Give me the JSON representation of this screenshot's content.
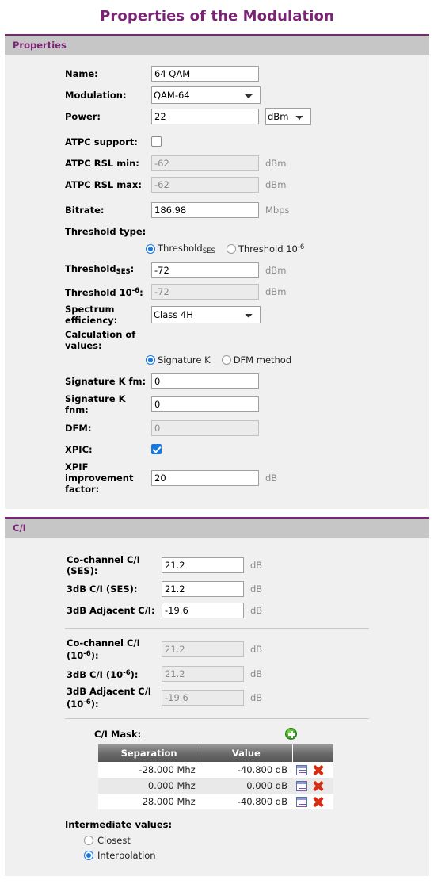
{
  "page": {
    "title": "Properties of the Modulation",
    "accent_color": "#7b2476"
  },
  "properties": {
    "section_title": "Properties",
    "name": {
      "label": "Name:",
      "value": "64 QAM"
    },
    "modulation": {
      "label": "Modulation:",
      "value": "QAM-64"
    },
    "power": {
      "label": "Power:",
      "value": "22",
      "unit_value": "dBm"
    },
    "atpc_support": {
      "label": "ATPC support:"
    },
    "atpc_rsl_min": {
      "label": "ATPC RSL min:",
      "value": "-62",
      "unit": "dBm"
    },
    "atpc_rsl_max": {
      "label": "ATPC RSL max:",
      "value": "-62",
      "unit": "dBm"
    },
    "bitrate": {
      "label": "Bitrate:",
      "value": "186.98",
      "unit": "Mbps"
    },
    "threshold_type": {
      "label": "Threshold type:",
      "option_ses_text": "Threshold",
      "option_ses_sub": "SES",
      "option_10_text": "Threshold 10",
      "option_10_sup": "-6"
    },
    "threshold_ses": {
      "label_text": "Threshold",
      "label_sub": "SES",
      "label_end": ":",
      "value": "-72",
      "unit": "dBm"
    },
    "threshold_10": {
      "label_text": "Threshold 10",
      "label_sup": "-6",
      "label_end": ":",
      "value": "-72",
      "unit": "dBm"
    },
    "spectrum_efficiency": {
      "label": "Spectrum efficiency:",
      "value": "Class 4H"
    },
    "calculation": {
      "label": "Calculation of values:",
      "option_signature": "Signature K",
      "option_dfm": "DFM method"
    },
    "signature_k_fm": {
      "label": "Signature K fm:",
      "value": "0"
    },
    "signature_k_fnm": {
      "label": "Signature K fnm:",
      "value": "0"
    },
    "dfm": {
      "label": "DFM:",
      "value": "0"
    },
    "xpic": {
      "label": "XPIC:"
    },
    "xpif": {
      "label": "XPIF improvement factor:",
      "value": "20",
      "unit": "dB"
    }
  },
  "ci": {
    "section_title": "C/I",
    "co_channel_ses": {
      "label": "Co-channel C/I (SES):",
      "value": "21.2",
      "unit": "dB"
    },
    "three_db_ses": {
      "label": "3dB C/I (SES):",
      "value": "21.2",
      "unit": "dB"
    },
    "three_db_adjacent": {
      "label": "3dB Adjacent C/I:",
      "value": "-19.6",
      "unit": "dB"
    },
    "co_channel_10": {
      "label_text": "Co-channel C/I (10",
      "label_sup": "-6",
      "label_end": "):",
      "value": "21.2",
      "unit": "dB"
    },
    "three_db_10": {
      "label_text": "3dB C/I (10",
      "label_sup": "-6",
      "label_end": "):",
      "value": "21.2",
      "unit": "dB"
    },
    "three_db_adjacent_10": {
      "label_text": "3dB Adjacent C/I (10",
      "label_sup": "-6",
      "label_end": "):",
      "value": "-19.6",
      "unit": "dB"
    },
    "mask": {
      "title": "C/I Mask:",
      "add_icon": "plus-circle-icon",
      "columns": [
        "Separation",
        "Value",
        ""
      ],
      "rows": [
        {
          "separation": "-28.000 Mhz",
          "value": "-40.800 dB"
        },
        {
          "separation": "0.000 Mhz",
          "value": "0.000 dB"
        },
        {
          "separation": "28.000 Mhz",
          "value": "-40.800 dB"
        }
      ]
    },
    "intermediate": {
      "label": "Intermediate values:",
      "option_closest": "Closest",
      "option_interpolation": "Interpolation"
    }
  }
}
